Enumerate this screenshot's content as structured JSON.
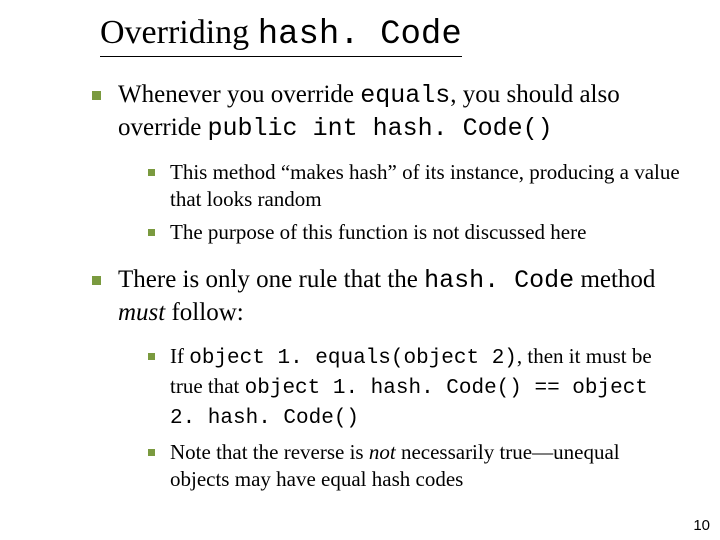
{
  "title": {
    "prefix": "Overriding ",
    "code": "hash. Code"
  },
  "bullets": [
    {
      "parts": [
        {
          "t": "Whenever you override "
        },
        {
          "t": "equals",
          "code": true
        },
        {
          "t": ", you should also override "
        },
        {
          "t": "public int hash. Code()",
          "code": true
        }
      ],
      "sub": [
        {
          "parts": [
            {
              "t": "This method “makes hash” of its instance, producing a value that looks random"
            }
          ]
        },
        {
          "parts": [
            {
              "t": "The purpose of this function is not discussed here"
            }
          ]
        }
      ]
    },
    {
      "parts": [
        {
          "t": "There is only one rule that the "
        },
        {
          "t": "hash. Code",
          "code": true
        },
        {
          "t": " method "
        },
        {
          "t": "must",
          "italic": true
        },
        {
          "t": " follow:"
        }
      ],
      "sub": [
        {
          "parts": [
            {
              "t": "If "
            },
            {
              "t": "object 1. equals(object 2)",
              "code": true
            },
            {
              "t": ", then it must be true that "
            },
            {
              "t": "object 1. hash. Code() == object 2. hash. Code()",
              "code": true
            }
          ]
        },
        {
          "parts": [
            {
              "t": "Note that the reverse is "
            },
            {
              "t": "not",
              "italic": true
            },
            {
              "t": " necessarily true—unequal objects may have equal hash codes"
            }
          ]
        }
      ]
    }
  ],
  "page_number": "10"
}
